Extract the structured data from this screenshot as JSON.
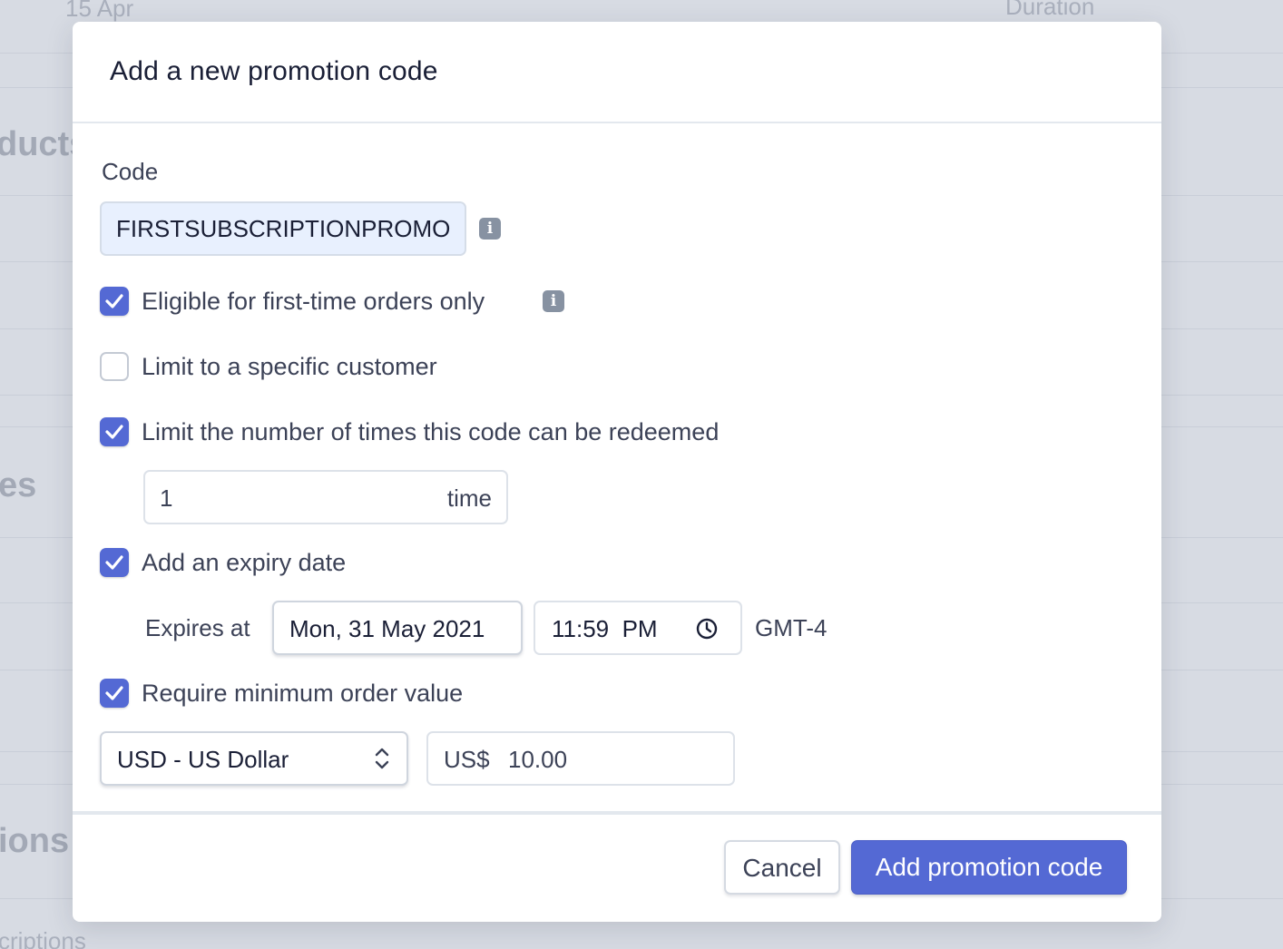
{
  "background": {
    "date_label": "15 Apr",
    "column_label": "Duration",
    "section_products": "ducts",
    "section_es": "es",
    "section_ions": "ions",
    "section_subscriptions": "criptions"
  },
  "modal": {
    "title": "Add a new promotion code",
    "code": {
      "label": "Code",
      "value": "FIRSTSUBSCRIPTIONPROMO"
    },
    "options": {
      "first_time": {
        "label": "Eligible for first-time orders only",
        "checked": true
      },
      "specific_customer": {
        "label": "Limit to a specific customer",
        "checked": false
      },
      "limit_redemptions": {
        "label": "Limit the number of times this code can be redeemed",
        "checked": true
      },
      "expiry": {
        "label": "Add an expiry date",
        "checked": true
      },
      "minimum_order": {
        "label": "Require minimum order value",
        "checked": true
      }
    },
    "redemptions": {
      "value": "1",
      "unit": "time"
    },
    "expiry_fields": {
      "label": "Expires at",
      "date": "Mon, 31 May 2021",
      "time": "11:59  PM",
      "timezone": "GMT-4"
    },
    "minimum_order_fields": {
      "currency": "USD - US Dollar",
      "amount_prefix": "US$",
      "amount": "10.00"
    },
    "buttons": {
      "cancel": "Cancel",
      "submit": "Add promotion code"
    }
  },
  "colors": {
    "accent": "#5469d4",
    "backdrop": "#d7dbe3"
  }
}
